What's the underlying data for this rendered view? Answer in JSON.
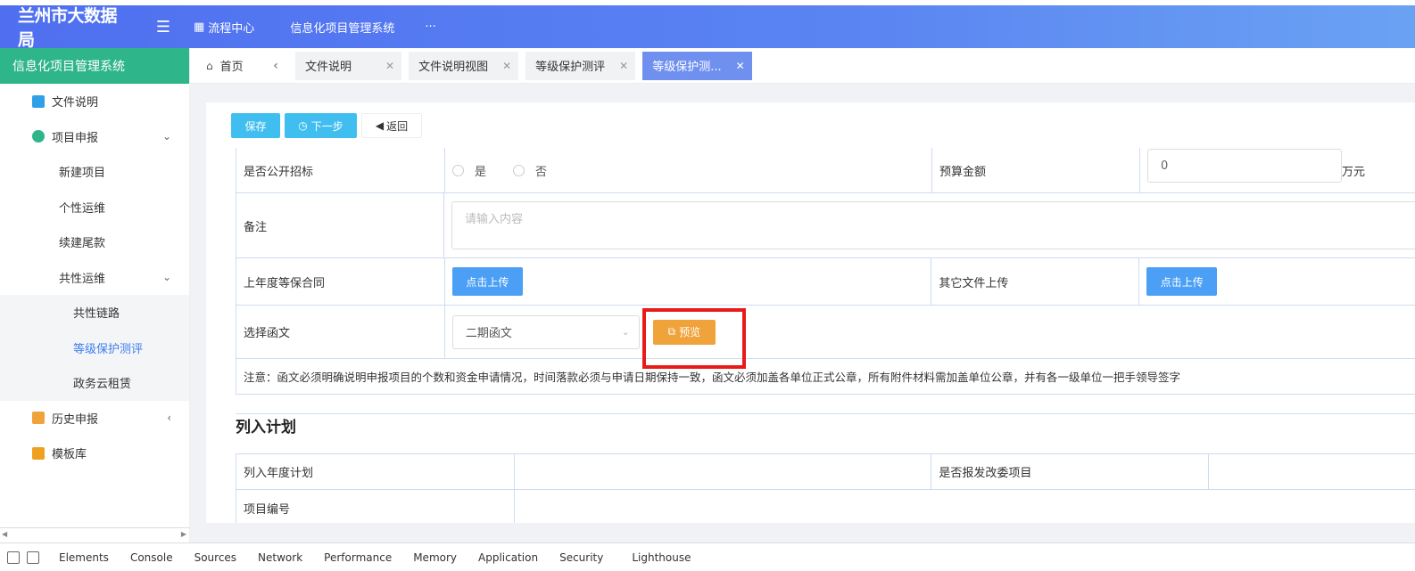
{
  "header": {
    "logo": "兰州市大数据局",
    "menu_toggle_icon": "menu-fold-icon",
    "nav": [
      {
        "label": "流程中心",
        "icon": "grid-icon"
      },
      {
        "label": "信息化项目管理系统"
      },
      {
        "label": "···"
      }
    ]
  },
  "sidebar": {
    "title": "信息化项目管理系统",
    "items": [
      {
        "label": "文件说明",
        "icon": "document-icon"
      },
      {
        "label": "项目申报",
        "icon": "user-icon"
      },
      {
        "label": "新建项目"
      },
      {
        "label": "个性运维"
      },
      {
        "label": "续建尾款"
      },
      {
        "label": "共性运维"
      },
      {
        "label": "共性链路"
      },
      {
        "label": "等级保护测评"
      },
      {
        "label": "政务云租赁"
      },
      {
        "label": "历史申报",
        "icon": "history-icon"
      },
      {
        "label": "模板库",
        "icon": "folder-icon"
      }
    ]
  },
  "tabs": {
    "home": "首页",
    "items": [
      {
        "label": "文件说明"
      },
      {
        "label": "文件说明视图"
      },
      {
        "label": "等级保护测评"
      },
      {
        "label": "等级保护测..."
      }
    ]
  },
  "toolbar": {
    "save": "保存",
    "next": "下一步",
    "back": "返回"
  },
  "form": {
    "public_bid_label": "是否公开招标",
    "yes": "是",
    "no": "否",
    "budget_label": "预算金额",
    "budget_value": "0",
    "budget_unit": "万元",
    "remark_label": "备注",
    "remark_placeholder": "请输入内容",
    "last_year_contract_label": "上年度等保合同",
    "upload": "点击上传",
    "other_files_label": "其它文件上传",
    "select_letter_label": "选择函文",
    "select_letter_value": "二期函文",
    "preview": "预览",
    "notice": "注意：函文必须明确说明申报项目的个数和资金申请情况，时间落款必须与申请日期保持一致，函文必须加盖各单位正式公章，所有附件材料需加盖单位公章，并有各一级单位一把手领导签字"
  },
  "plan": {
    "title": "列入计划",
    "annual_plan_label": "列入年度计划",
    "reform_label": "是否报发改委项目",
    "project_no_label": "项目编号"
  },
  "devtools": {
    "tabs": [
      "Elements",
      "Console",
      "Sources",
      "Network",
      "Performance",
      "Memory",
      "Application",
      "Security",
      "Lighthouse"
    ]
  },
  "colors": {
    "header": "#5a84f2",
    "sidebar_title": "#2fb58a",
    "active_tab": "#7090f0",
    "primary_button": "#41bef0",
    "upload_button": "#4ba0f5",
    "preview_button": "#f0a33b",
    "highlight": "#e81a1a"
  }
}
